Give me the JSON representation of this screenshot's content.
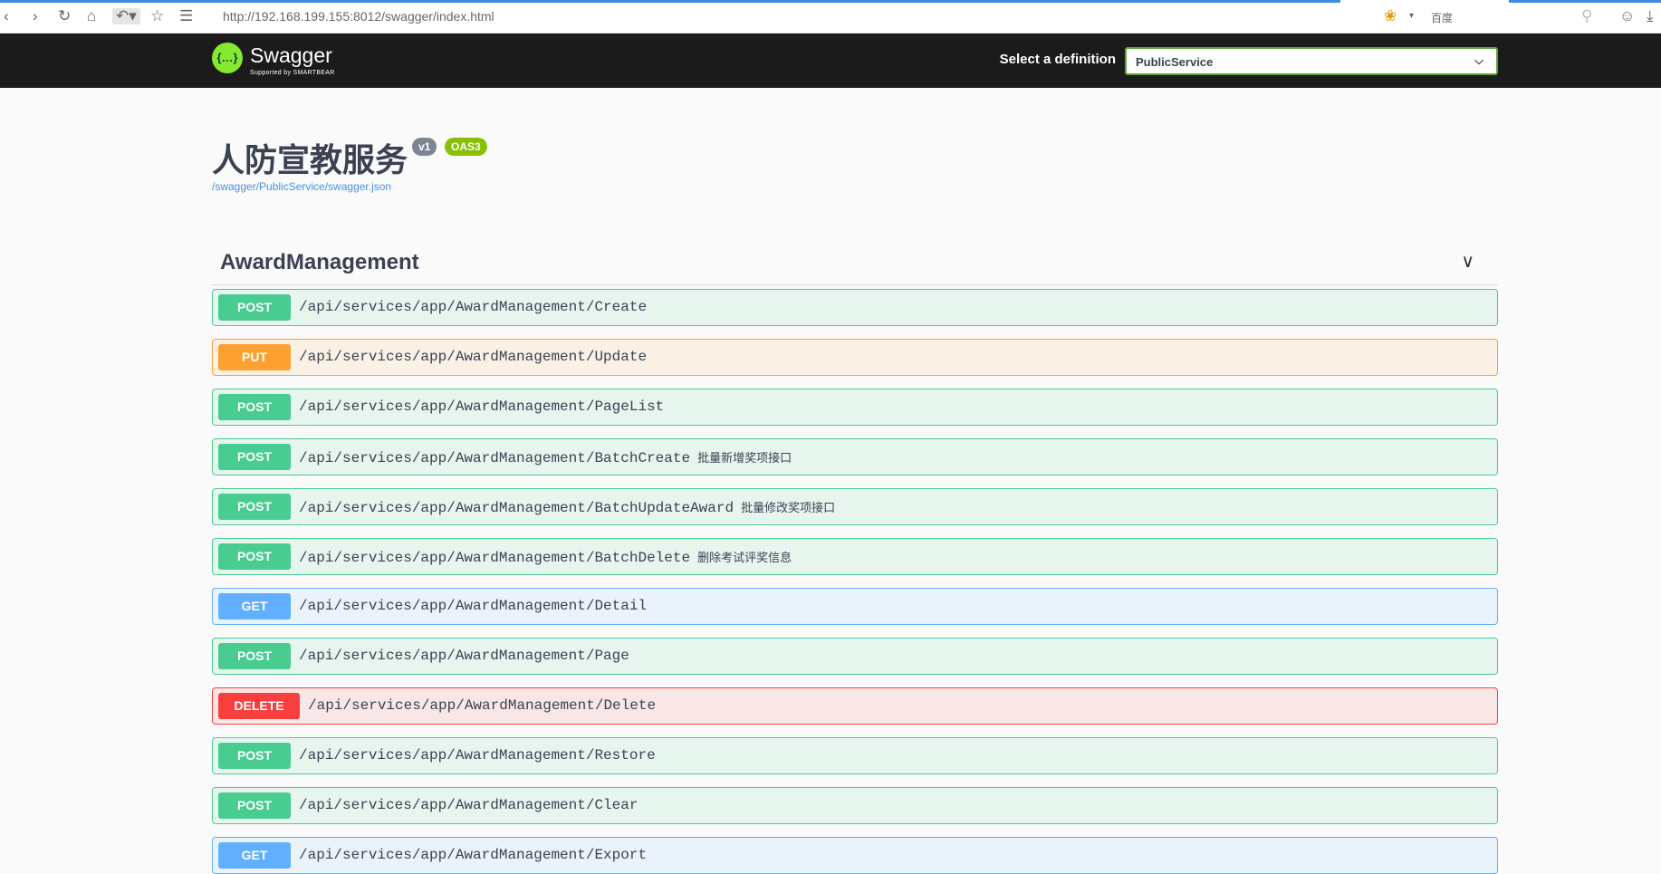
{
  "browser": {
    "url": "http://192.168.199.155:8012/swagger/index.html",
    "search_engine": "百度"
  },
  "header": {
    "logo_text": "Swagger",
    "logo_sub": "Supported by SMARTBEAR",
    "definition_label": "Select a definition",
    "definition_value": "PublicService"
  },
  "info": {
    "title": "人防宣教服务",
    "version": "v1",
    "oas": "OAS3",
    "spec_link": "/swagger/PublicService/swagger.json"
  },
  "section": {
    "title": "AwardManagement"
  },
  "colors": {
    "POST": "#49cc90",
    "PUT": "#fca130",
    "GET": "#61affe",
    "DELETE": "#f93e3e"
  },
  "operations": [
    {
      "method": "POST",
      "path": "/api/services/app/AwardManagement/Create",
      "desc": ""
    },
    {
      "method": "PUT",
      "path": "/api/services/app/AwardManagement/Update",
      "desc": ""
    },
    {
      "method": "POST",
      "path": "/api/services/app/AwardManagement/PageList",
      "desc": ""
    },
    {
      "method": "POST",
      "path": "/api/services/app/AwardManagement/BatchCreate",
      "desc": "批量新增奖项接口"
    },
    {
      "method": "POST",
      "path": "/api/services/app/AwardManagement/BatchUpdateAward",
      "desc": "批量修改奖项接口"
    },
    {
      "method": "POST",
      "path": "/api/services/app/AwardManagement/BatchDelete",
      "desc": "删除考试评奖信息"
    },
    {
      "method": "GET",
      "path": "/api/services/app/AwardManagement/Detail",
      "desc": ""
    },
    {
      "method": "POST",
      "path": "/api/services/app/AwardManagement/Page",
      "desc": ""
    },
    {
      "method": "DELETE",
      "path": "/api/services/app/AwardManagement/Delete",
      "desc": ""
    },
    {
      "method": "POST",
      "path": "/api/services/app/AwardManagement/Restore",
      "desc": ""
    },
    {
      "method": "POST",
      "path": "/api/services/app/AwardManagement/Clear",
      "desc": ""
    },
    {
      "method": "GET",
      "path": "/api/services/app/AwardManagement/Export",
      "desc": ""
    }
  ]
}
